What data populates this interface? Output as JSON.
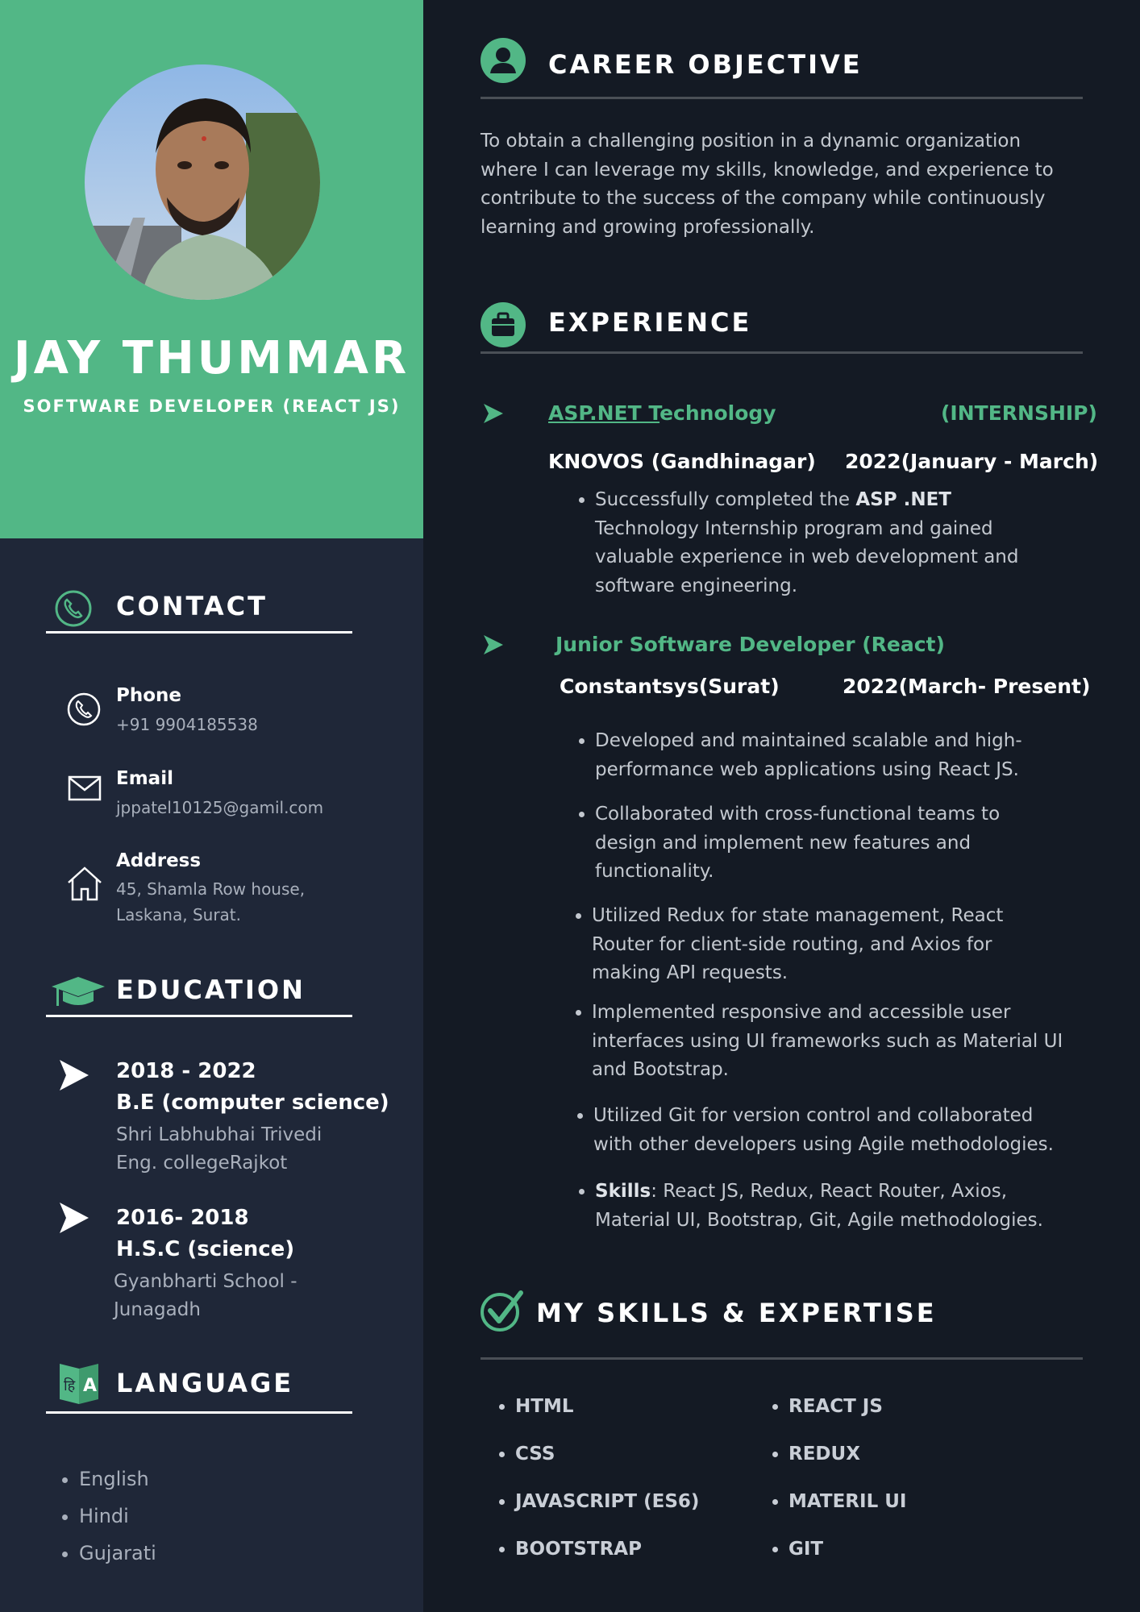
{
  "colors": {
    "accent": "#52b786",
    "left_bg": "#1f2738",
    "right_bg": "#141a24"
  },
  "profile": {
    "name": "JAY THUMMAR",
    "role": "SOFTWARE DEVELOPER (REACT JS)"
  },
  "contact": {
    "heading": "CONTACT",
    "phone_label": "Phone",
    "phone_value": "+91 9904185538",
    "email_label": "Email",
    "email_value": "jppatel10125@gamil.com",
    "address_label": "Address",
    "address_line1": "45, Shamla Row house,",
    "address_line2": "Laskana, Surat."
  },
  "education": {
    "heading": "EDUCATION",
    "items": [
      {
        "years": "2018 - 2022",
        "degree": "B.E (computer science)",
        "school_line1": "Shri Labhubhai Trivedi",
        "school_line2": "Eng. collegeRajkot"
      },
      {
        "years": "2016- 2018",
        "degree": "H.S.C (science)",
        "school_line1": "Gyanbharti School -",
        "school_line2": "Junagadh"
      }
    ]
  },
  "language": {
    "heading": "LANGUAGE",
    "items": [
      "English",
      "Hindi",
      "Gujarati"
    ]
  },
  "objective": {
    "heading": "CAREER OBJECTIVE",
    "lines": [
      "To obtain a challenging position in a dynamic organization",
      "where I can leverage my skills, knowledge, and experience to",
      "contribute to the success of the company while continuously",
      "learning and growing professionally."
    ]
  },
  "experience": {
    "heading": "EXPERIENCE",
    "jobs": [
      {
        "title_underlined": "ASP.NET T",
        "title_rest": "echnology",
        "type": "(INTERNSHIP)",
        "company": "KNOVOS (Gandhinagar)",
        "period": "2022(January - March)",
        "bullet_prefix": "Successfully completed the ",
        "bullet_bold": "ASP .NET",
        "bullet_lines": [
          "Technology Internship program and gained",
          "valuable experience in web development and",
          "software engineering."
        ]
      },
      {
        "title": "Junior Software Developer (React)",
        "company": "Constantsys(Surat)",
        "period": "2022(March- Present)",
        "bullets": [
          [
            "Developed and maintained scalable and high-",
            "performance web applications using React JS."
          ],
          [
            "Collaborated with cross-functional teams to",
            "design and implement new features and",
            "functionality."
          ],
          [
            "Utilized Redux for state management, React",
            "Router for client-side routing, and Axios for",
            "making API requests."
          ],
          [
            "Implemented responsive and accessible user",
            "interfaces using UI frameworks such as Material UI",
            "and Bootstrap."
          ],
          [
            "Utilized Git for version control and collaborated",
            "with other developers using Agile methodologies."
          ]
        ],
        "skills_label": "Skills",
        "skills_line1": ": React JS, Redux, React Router, Axios,",
        "skills_line2": "Material UI, Bootstrap, Git, Agile methodologies."
      }
    ]
  },
  "skills": {
    "heading": "MY SKILLS & EXPERTISE",
    "col1": [
      "HTML",
      "CSS",
      "JAVASCRIPT (ES6)",
      "BOOTSTRAP"
    ],
    "col2": [
      "REACT JS",
      "REDUX",
      "MATERIL UI",
      "GIT"
    ]
  }
}
